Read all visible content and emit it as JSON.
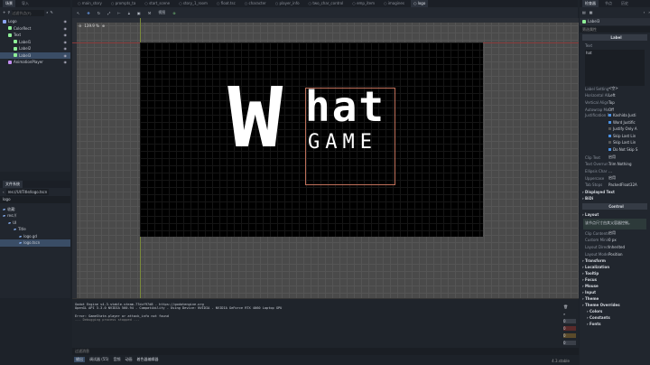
{
  "scene_dock": {
    "tabs": [
      "场景",
      "导入"
    ],
    "filter_placeholder": "过滤节点(F)",
    "tree": [
      {
        "name": "Logo",
        "type": "Node2D",
        "color": "#8da5f3",
        "indent": 0
      },
      {
        "name": "ColorRect",
        "type": "ColorRect",
        "color": "#8eef97",
        "indent": 1
      },
      {
        "name": "Text",
        "type": "Node2D",
        "color": "#8eef97",
        "indent": 1
      },
      {
        "name": "Label1",
        "type": "Label",
        "color": "#8eef97",
        "indent": 2
      },
      {
        "name": "Label2",
        "type": "Label",
        "color": "#8eef97",
        "indent": 2
      },
      {
        "name": "Label3",
        "type": "Label",
        "color": "#8eef97",
        "indent": 2,
        "selected": true
      },
      {
        "name": "AnimationPlayer",
        "type": "AnimationPlayer",
        "color": "#c38ef1",
        "indent": 1
      }
    ]
  },
  "filesystem": {
    "title": "文件系统",
    "path": "res://UI/Title/logo.tscn",
    "filter": "logo",
    "tree": [
      {
        "name": "收藏:",
        "indent": 0
      },
      {
        "name": "res://",
        "indent": 0
      },
      {
        "name": "UI",
        "indent": 1
      },
      {
        "name": "Title",
        "indent": 2
      },
      {
        "name": "logo.gd",
        "indent": 3
      },
      {
        "name": "logo.tscn",
        "indent": 3,
        "selected": true
      }
    ]
  },
  "editor_tabs": [
    "main_story",
    "prompts_ta",
    "start_scene",
    "story_1_room",
    "float.tsc",
    "character",
    "player_info",
    "two_char_control",
    "emp_item",
    "imagines",
    "logo"
  ],
  "toolbar": {
    "view_label": "视图",
    "zoom": "139.9 %"
  },
  "canvas": {
    "logo_big": "W",
    "logo_hat": "hat",
    "logo_game": "GAME"
  },
  "output": {
    "lines": [
      "Godot Engine v4.3.stable.steam.77dcf97d8 - https://godotengine.org",
      "OpenGL API 3.3.0 NVIDIA 560.94 - Compatibility - Using Device: NVIDIA - NVIDIA GeForce RTX 4060 Laptop GPU",
      "",
      "Error: GameState.player or attack_info not found",
      "--- Debugging process stopped ---"
    ],
    "filter_placeholder": "过滤消息",
    "bottom_tabs": [
      "输出",
      "调试器 (55)",
      "音频",
      "动画",
      "着色器编辑器"
    ],
    "version": "4.3.stable",
    "counts": [
      "0",
      "0",
      "0",
      "0"
    ]
  },
  "inspector": {
    "tabs": [
      "检查器",
      "节点",
      "历史"
    ],
    "node": "Label3",
    "filter_placeholder": "筛选属性",
    "class_header": "Label",
    "text_label": "Text",
    "text_value": "hat",
    "props": [
      [
        "Label Settings",
        "<空>"
      ],
      [
        "Horizontal Alignment",
        "Left"
      ],
      [
        "Vertical Alignment",
        "Top"
      ],
      [
        "Autowrap Mode",
        "Off"
      ]
    ],
    "justification_label": "Justification Flags",
    "flags": [
      [
        "Kashida Justi",
        true
      ],
      [
        "Word Justific",
        true
      ],
      [
        "Justify Only A",
        false
      ],
      [
        "Skip Last Lin",
        true
      ],
      [
        "Skip Last Lin",
        false
      ],
      [
        "Do Not Skip S",
        true
      ]
    ],
    "props2": [
      [
        "Clip Text",
        "启用"
      ],
      [
        "Text Overrun Behavior",
        "Trim Nothing"
      ],
      [
        "Ellipsis Char",
        "…"
      ],
      [
        "Uppercase",
        "启用"
      ],
      [
        "Tab Stops",
        "PackedFloat32A"
      ]
    ],
    "sections": [
      "Displayed Text",
      "BiDi"
    ],
    "control_header": "Control",
    "layout_label": "Layout",
    "warning": "该节点尺寸由其父容器控制。",
    "layout_props": [
      [
        "Clip Contents",
        "启用"
      ],
      [
        "Custom Minimum Size",
        "0 px"
      ],
      [
        "Layout Direction",
        "Inherited"
      ],
      [
        "Layout Mode",
        "Position"
      ]
    ],
    "groups": [
      "Transform",
      "Localization",
      "Tooltip",
      "Focus",
      "Mouse",
      "Input",
      "Theme",
      "Theme Overrides",
      "Colors",
      "Constants",
      "Fonts"
    ]
  }
}
